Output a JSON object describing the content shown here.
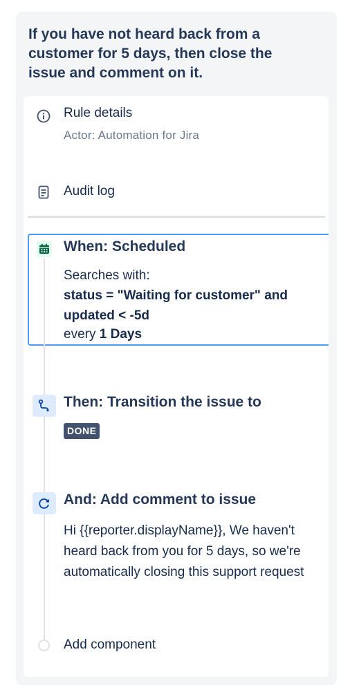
{
  "rule": {
    "title": "If you have not heard back from a customer for 5 days, then close the issue and comment on it."
  },
  "rule_details": {
    "label": "Rule details",
    "actor": "Actor: Automation for Jira"
  },
  "audit_log": {
    "label": "Audit log"
  },
  "trigger": {
    "title": "When: Scheduled",
    "searches_label": "Searches with:",
    "jql_line1": "status = \"Waiting for customer\" and",
    "jql_line2": "updated < -5d",
    "every_prefix": "every ",
    "every_value": "1 Days"
  },
  "action_transition": {
    "title": "Then: Transition the issue to",
    "status": "DONE"
  },
  "action_comment": {
    "title": "And: Add comment to issue",
    "line1": "Hi {{reporter.displayName}}, We haven't",
    "line2": "heard back from you for 5 days, so we're",
    "line3": "automatically closing this support request"
  },
  "add_component": {
    "label": "Add component"
  },
  "colors": {
    "accent_blue": "#4C9AFF",
    "trigger_icon": "#006644",
    "action_icon_bg": "#DEEBFF",
    "lozenge_bg": "#42526E"
  }
}
